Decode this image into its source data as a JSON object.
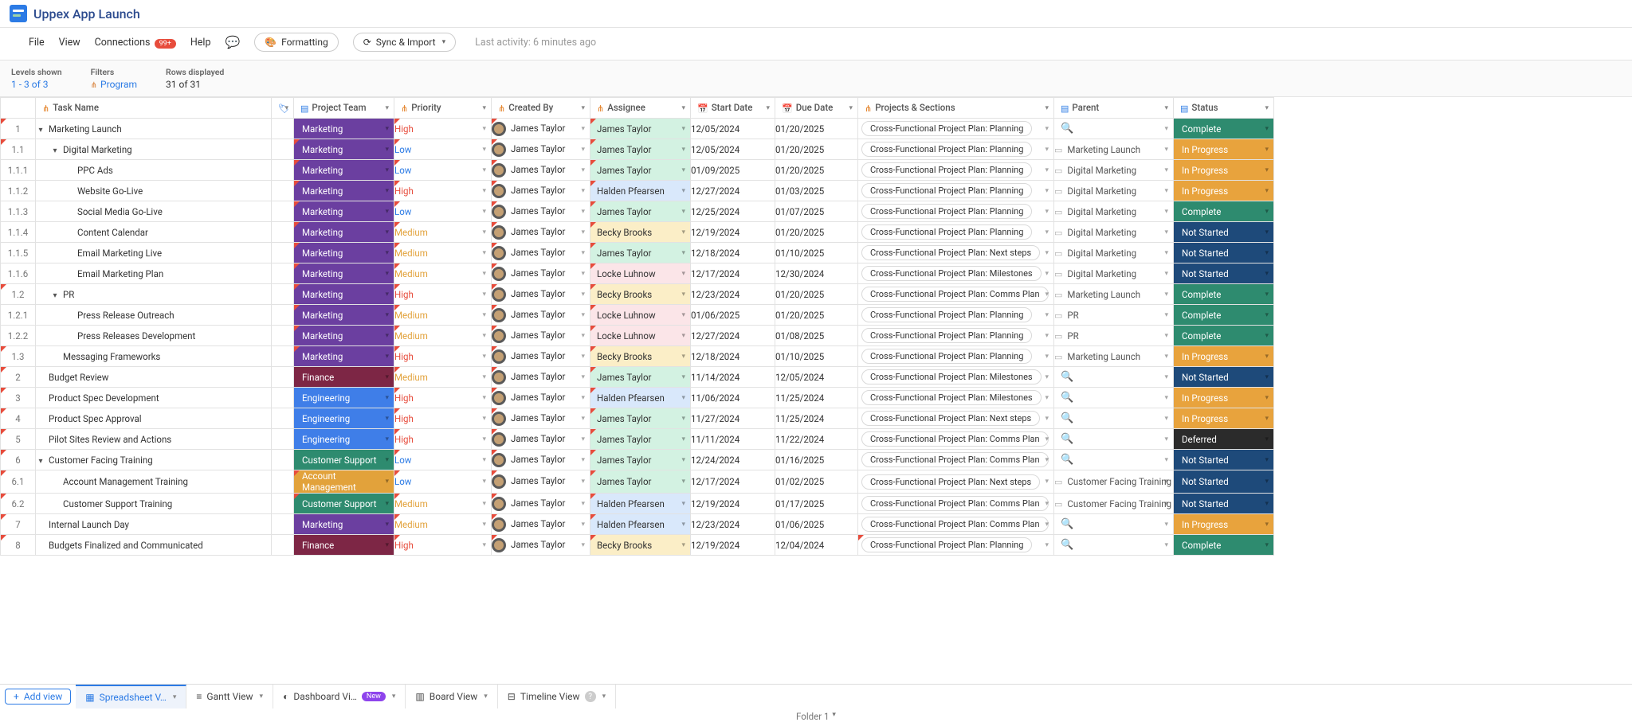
{
  "header": {
    "title": "Uppex App Launch"
  },
  "toolbar": {
    "menus": [
      "File",
      "View",
      "Connections"
    ],
    "connections_badge": "99+",
    "help": "Help",
    "formatting": "Formatting",
    "sync": "Sync & Import",
    "last_activity_label": "Last activity:",
    "last_activity_value": "6 minutes ago"
  },
  "info": {
    "levels_label": "Levels shown",
    "levels_value": "1 - 3 of 3",
    "filters_label": "Filters",
    "filters_value": "Program",
    "rows_label": "Rows displayed",
    "rows_value": "31 of 31"
  },
  "columns": [
    "Task Name",
    "Project Team",
    "Priority",
    "Created By",
    "Assignee",
    "Start Date",
    "Due Date",
    "Projects & Sections",
    "Parent",
    "Status"
  ],
  "rows": [
    {
      "num": "1",
      "indent": 0,
      "chev": true,
      "task": "Marketing Launch",
      "team": "Marketing",
      "teamc": "t-marketing",
      "pri": "High",
      "pric": "pri-high",
      "cre": "James Taylor",
      "ass": "James Taylor",
      "assc": "a-jt",
      "sd": "12/05/2024",
      "dd": "01/20/2025",
      "ps": "Cross-Functional Project Plan: Planning",
      "parent": "",
      "status": "Complete",
      "statc": "s-complete",
      "cnum": true,
      "cteam": false
    },
    {
      "num": "1.1",
      "indent": 1,
      "chev": true,
      "task": "Digital Marketing",
      "team": "Marketing",
      "teamc": "t-marketing",
      "pri": "Low",
      "pric": "pri-low",
      "cre": "James Taylor",
      "ass": "James Taylor",
      "assc": "a-jt",
      "sd": "12/05/2024",
      "dd": "01/20/2025",
      "ps": "Cross-Functional Project Plan: Planning",
      "parent": "Marketing Launch",
      "status": "In Progress",
      "statc": "s-inprog",
      "cnum": true,
      "cteam": true
    },
    {
      "num": "1.1.1",
      "indent": 2,
      "chev": false,
      "task": "PPC Ads",
      "team": "Marketing",
      "teamc": "t-marketing",
      "pri": "Low",
      "pric": "pri-low",
      "cre": "James Taylor",
      "ass": "James Taylor",
      "assc": "a-jt",
      "sd": "01/09/2025",
      "dd": "01/20/2025",
      "ps": "Cross-Functional Project Plan: Planning",
      "parent": "Digital Marketing",
      "status": "In Progress",
      "statc": "s-inprog",
      "cnum": false,
      "cteam": true
    },
    {
      "num": "1.1.2",
      "indent": 2,
      "chev": false,
      "task": "Website Go-Live",
      "team": "Marketing",
      "teamc": "t-marketing",
      "pri": "High",
      "pric": "pri-high",
      "cre": "James Taylor",
      "ass": "Halden Pfearsen",
      "assc": "a-hp",
      "sd": "12/27/2024",
      "dd": "01/03/2025",
      "ps": "Cross-Functional Project Plan: Planning",
      "parent": "Digital Marketing",
      "status": "In Progress",
      "statc": "s-inprog",
      "cnum": false,
      "cteam": true
    },
    {
      "num": "1.1.3",
      "indent": 2,
      "chev": false,
      "task": "Social Media Go-Live",
      "team": "Marketing",
      "teamc": "t-marketing",
      "pri": "Low",
      "pric": "pri-low",
      "cre": "James Taylor",
      "ass": "James Taylor",
      "assc": "a-jt",
      "sd": "12/25/2024",
      "dd": "01/07/2025",
      "ps": "Cross-Functional Project Plan: Planning",
      "parent": "Digital Marketing",
      "status": "Complete",
      "statc": "s-complete",
      "cnum": false,
      "cteam": true
    },
    {
      "num": "1.1.4",
      "indent": 2,
      "chev": false,
      "task": "Content Calendar",
      "team": "Marketing",
      "teamc": "t-marketing",
      "pri": "Medium",
      "pric": "pri-medium",
      "cre": "James Taylor",
      "ass": "Becky Brooks",
      "assc": "a-bb",
      "sd": "12/19/2024",
      "dd": "01/20/2025",
      "ps": "Cross-Functional Project Plan: Planning",
      "parent": "Digital Marketing",
      "status": "Not Started",
      "statc": "s-notstart",
      "cnum": false,
      "cteam": true
    },
    {
      "num": "1.1.5",
      "indent": 2,
      "chev": false,
      "task": "Email Marketing Live",
      "team": "Marketing",
      "teamc": "t-marketing",
      "pri": "Medium",
      "pric": "pri-medium",
      "cre": "James Taylor",
      "ass": "James Taylor",
      "assc": "a-jt",
      "sd": "12/18/2024",
      "dd": "01/10/2025",
      "ps": "Cross-Functional Project Plan: Next steps",
      "parent": "Digital Marketing",
      "status": "Not Started",
      "statc": "s-notstart",
      "cnum": false,
      "cteam": true
    },
    {
      "num": "1.1.6",
      "indent": 2,
      "chev": false,
      "task": "Email Marketing Plan",
      "team": "Marketing",
      "teamc": "t-marketing",
      "pri": "Medium",
      "pric": "pri-medium",
      "cre": "James Taylor",
      "ass": "Locke Luhnow",
      "assc": "a-ll",
      "sd": "12/17/2024",
      "dd": "12/30/2024",
      "ps": "Cross-Functional Project Plan: Milestones",
      "parent": "Digital Marketing",
      "status": "Not Started",
      "statc": "s-notstart",
      "cnum": false,
      "cteam": true
    },
    {
      "num": "1.2",
      "indent": 1,
      "chev": true,
      "task": "PR",
      "team": "Marketing",
      "teamc": "t-marketing",
      "pri": "High",
      "pric": "pri-high",
      "cre": "James Taylor",
      "ass": "Becky Brooks",
      "assc": "a-bb",
      "sd": "12/23/2024",
      "dd": "01/20/2025",
      "ps": "Cross-Functional Project Plan: Comms Plan",
      "parent": "Marketing Launch",
      "status": "Complete",
      "statc": "s-complete",
      "cnum": true,
      "cteam": true
    },
    {
      "num": "1.2.1",
      "indent": 2,
      "chev": false,
      "task": "Press Release Outreach",
      "team": "Marketing",
      "teamc": "t-marketing",
      "pri": "Medium",
      "pric": "pri-medium",
      "cre": "James Taylor",
      "ass": "Locke Luhnow",
      "assc": "a-ll",
      "sd": "01/06/2025",
      "dd": "01/20/2025",
      "ps": "Cross-Functional Project Plan: Planning",
      "parent": "PR",
      "status": "Complete",
      "statc": "s-complete",
      "cnum": false,
      "cteam": true
    },
    {
      "num": "1.2.2",
      "indent": 2,
      "chev": false,
      "task": "Press Releases Development",
      "team": "Marketing",
      "teamc": "t-marketing",
      "pri": "Medium",
      "pric": "pri-medium",
      "cre": "James Taylor",
      "ass": "Locke Luhnow",
      "assc": "a-ll",
      "sd": "12/27/2024",
      "dd": "01/08/2025",
      "ps": "Cross-Functional Project Plan: Planning",
      "parent": "PR",
      "status": "Complete",
      "statc": "s-complete",
      "cnum": false,
      "cteam": true
    },
    {
      "num": "1.3",
      "indent": 1,
      "chev": false,
      "task": "Messaging Frameworks",
      "team": "Marketing",
      "teamc": "t-marketing",
      "pri": "High",
      "pric": "pri-high",
      "cre": "James Taylor",
      "ass": "Becky Brooks",
      "assc": "a-bb",
      "sd": "12/18/2024",
      "dd": "01/10/2025",
      "ps": "Cross-Functional Project Plan: Planning",
      "parent": "Marketing Launch",
      "status": "In Progress",
      "statc": "s-inprog",
      "cnum": true,
      "cteam": true
    },
    {
      "num": "2",
      "indent": 0,
      "chev": false,
      "task": "Budget Review",
      "team": "Finance",
      "teamc": "t-finance",
      "pri": "Medium",
      "pric": "pri-medium",
      "cre": "James Taylor",
      "ass": "James Taylor",
      "assc": "a-jt",
      "sd": "11/14/2024",
      "dd": "12/05/2024",
      "ps": "Cross-Functional Project Plan: Milestones",
      "parent": "",
      "status": "Not Started",
      "statc": "s-notstart",
      "cnum": true,
      "cteam": false
    },
    {
      "num": "3",
      "indent": 0,
      "chev": false,
      "task": "Product Spec Development",
      "team": "Engineering",
      "teamc": "t-engineering",
      "pri": "High",
      "pric": "pri-high",
      "cre": "James Taylor",
      "ass": "Halden Pfearsen",
      "assc": "a-hp",
      "sd": "11/06/2024",
      "dd": "11/25/2024",
      "ps": "Cross-Functional Project Plan: Milestones",
      "parent": "",
      "status": "In Progress",
      "statc": "s-inprog",
      "cnum": true,
      "cteam": false
    },
    {
      "num": "4",
      "indent": 0,
      "chev": false,
      "task": "Product Spec Approval",
      "team": "Engineering",
      "teamc": "t-engineering",
      "pri": "High",
      "pric": "pri-high",
      "cre": "James Taylor",
      "ass": "James Taylor",
      "assc": "a-jt",
      "sd": "11/27/2024",
      "dd": "11/25/2024",
      "ps": "Cross-Functional Project Plan: Next steps",
      "parent": "",
      "status": "In Progress",
      "statc": "s-inprog",
      "cnum": true,
      "cteam": false
    },
    {
      "num": "5",
      "indent": 0,
      "chev": false,
      "task": "Pilot Sites Review and Actions",
      "team": "Engineering",
      "teamc": "t-engineering",
      "pri": "High",
      "pric": "pri-high",
      "cre": "James Taylor",
      "ass": "James Taylor",
      "assc": "a-jt",
      "sd": "11/11/2024",
      "dd": "11/22/2024",
      "ps": "Cross-Functional Project Plan: Comms Plan",
      "parent": "",
      "status": "Deferred",
      "statc": "s-deferred",
      "cnum": true,
      "cteam": false
    },
    {
      "num": "6",
      "indent": 0,
      "chev": true,
      "task": "Customer Facing Training",
      "team": "Customer Support",
      "teamc": "t-custsupp",
      "pri": "Low",
      "pric": "pri-low",
      "cre": "James Taylor",
      "ass": "James Taylor",
      "assc": "a-jt",
      "sd": "12/24/2024",
      "dd": "01/16/2025",
      "ps": "Cross-Functional Project Plan: Comms Plan",
      "parent": "",
      "status": "Not Started",
      "statc": "s-notstart",
      "cnum": true,
      "cteam": false
    },
    {
      "num": "6.1",
      "indent": 1,
      "chev": false,
      "task": "Account Management Training",
      "team": "Account Management",
      "teamc": "t-acctmgmt",
      "pri": "Low",
      "pric": "pri-low",
      "cre": "James Taylor",
      "ass": "James Taylor",
      "assc": "a-jt",
      "sd": "12/17/2024",
      "dd": "01/02/2025",
      "ps": "Cross-Functional Project Plan: Next steps",
      "parent": "Customer Facing Training",
      "status": "Not Started",
      "statc": "s-notstart",
      "cnum": true,
      "cteam": true
    },
    {
      "num": "6.2",
      "indent": 1,
      "chev": false,
      "task": "Customer Support Training",
      "team": "Customer Support",
      "teamc": "t-custsupp",
      "pri": "Medium",
      "pric": "pri-medium",
      "cre": "James Taylor",
      "ass": "Halden Pfearsen",
      "assc": "a-hp",
      "sd": "12/19/2024",
      "dd": "01/17/2025",
      "ps": "Cross-Functional Project Plan: Comms Plan",
      "parent": "Customer Facing Training",
      "status": "Not Started",
      "statc": "s-notstart",
      "cnum": true,
      "cteam": true
    },
    {
      "num": "7",
      "indent": 0,
      "chev": false,
      "task": "Internal Launch Day",
      "team": "Marketing",
      "teamc": "t-marketing",
      "pri": "Medium",
      "pric": "pri-medium",
      "cre": "James Taylor",
      "ass": "Halden Pfearsen",
      "assc": "a-hp",
      "sd": "12/23/2024",
      "dd": "01/06/2025",
      "ps": "Cross-Functional Project Plan: Comms Plan",
      "parent": "",
      "status": "In Progress",
      "statc": "s-inprog",
      "cnum": true,
      "cteam": false
    },
    {
      "num": "8",
      "indent": 0,
      "chev": false,
      "task": "Budgets Finalized and Communicated",
      "team": "Finance",
      "teamc": "t-finance",
      "pri": "High",
      "pric": "pri-high",
      "cre": "James Taylor",
      "ass": "Becky Brooks",
      "assc": "a-bb",
      "sd": "12/19/2024",
      "dd": "12/04/2024",
      "ps": "Cross-Functional Project Plan: Planning",
      "parent": "",
      "status": "Complete",
      "statc": "s-complete",
      "cnum": true,
      "cteam": false,
      "cps": true
    }
  ],
  "tabs": {
    "add": "Add view",
    "sheet": "Spreadsheet V…",
    "gantt": "Gantt View",
    "dash": "Dashboard Vi…",
    "dash_new": "New",
    "board": "Board View",
    "timeline": "Timeline View"
  },
  "folder": "Folder 1"
}
